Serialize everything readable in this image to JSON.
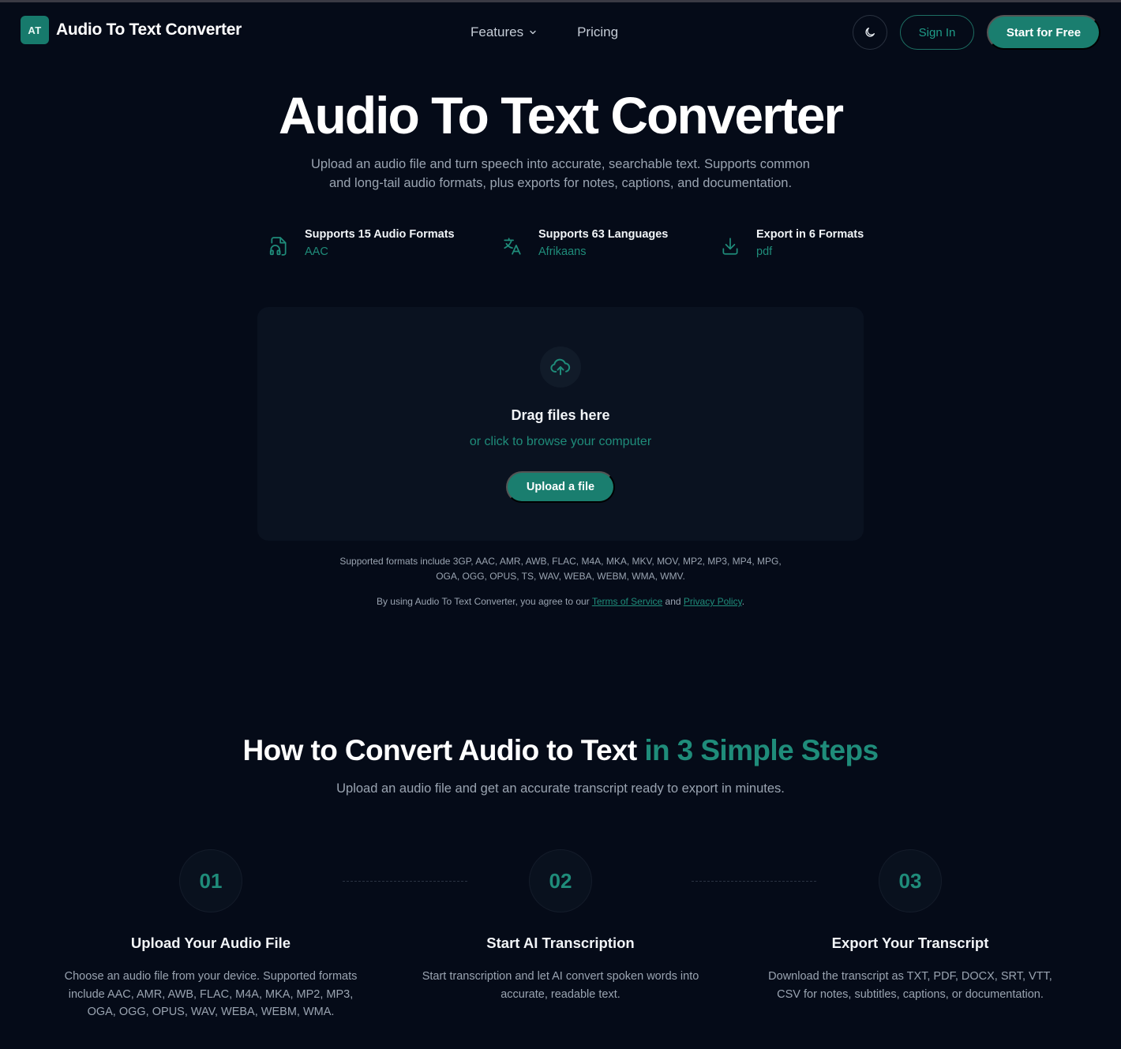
{
  "header": {
    "logo_badge": "AT",
    "logo_text": "Audio To Text Converter",
    "nav": [
      {
        "label": "Features"
      },
      {
        "label": "Pricing"
      }
    ],
    "signin_label": "Sign In",
    "start_label": "Start for Free"
  },
  "hero": {
    "title": "Audio To Text Converter",
    "subtitle": "Upload an audio file and turn speech into accurate, searchable text. Supports common and long-tail audio formats, plus exports for notes, captions, and documentation."
  },
  "features": [
    {
      "title": "Supports 15 Audio Formats",
      "value": "AAC",
      "icon": "audio-file-icon"
    },
    {
      "title": "Supports 63 Languages",
      "value": "Afrikaans",
      "icon": "translate-icon"
    },
    {
      "title": "Export in 6 Formats",
      "value": "pdf",
      "icon": "download-icon"
    }
  ],
  "upload": {
    "title": "Drag files here",
    "subtitle": "or click to browse your computer",
    "button_label": "Upload a file"
  },
  "notes": {
    "formats": "Supported formats include 3GP, AAC, AMR, AWB, FLAC, M4A, MKA, MKV, MOV, MP2, MP3, MP4, MPG, OGA, OGG, OPUS, TS, WAV, WEBA, WEBM, WMA, WMV.",
    "agree_prefix": "By using Audio To Text Converter, you agree to our",
    "terms_label": "Terms of Service",
    "and": "and",
    "privacy_label": "Privacy Policy",
    "period": "."
  },
  "how": {
    "title_main": "How to Convert Audio to Text",
    "title_accent": "in 3 Simple Steps",
    "subtitle": "Upload an audio file and get an accurate transcript ready to export in minutes.",
    "steps": [
      {
        "num": "01",
        "title": "Upload Your Audio File",
        "desc": "Choose an audio file from your device. Supported formats include AAC, AMR, AWB, FLAC, M4A, MKA, MP2, MP3, OGA, OGG, OPUS, WAV, WEBA, WEBM, WMA."
      },
      {
        "num": "02",
        "title": "Start AI Transcription",
        "desc": "Start transcription and let AI convert spoken words into accurate, readable text."
      },
      {
        "num": "03",
        "title": "Export Your Transcript",
        "desc": "Download the transcript as TXT, PDF, DOCX, SRT, VTT, CSV for notes, subtitles, captions, or documentation."
      }
    ]
  },
  "colors": {
    "background": "#050b18",
    "accent": "#1a7e6f",
    "accent_text": "#1f8c7a",
    "muted_text": "#9aa4b1"
  }
}
